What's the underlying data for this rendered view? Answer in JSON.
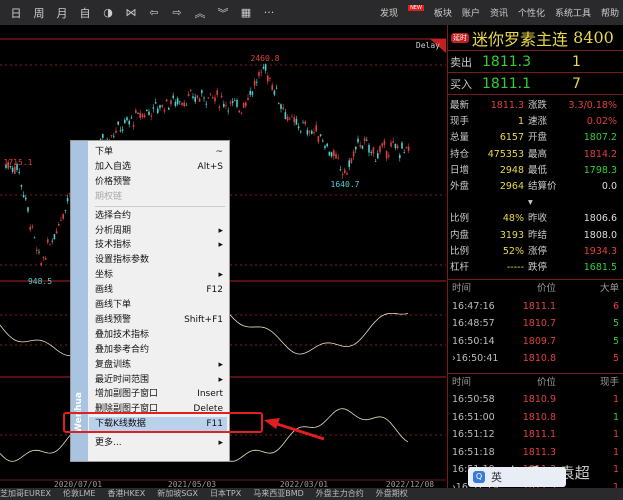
{
  "toolbar": {
    "items": [
      "日",
      "周",
      "月",
      "自",
      "◑",
      "⋈",
      "⇦",
      "⇨",
      "︽",
      "︾",
      "▦",
      "···"
    ],
    "menu": [
      "发现",
      "板块",
      "账户",
      "资讯",
      "个性化",
      "系统工具",
      "帮助"
    ],
    "new_badge": "NEW"
  },
  "chart": {
    "delay_label": "Delay",
    "price_labels": {
      "high": "2460.8",
      "left": "1715.1",
      "low": "948.5",
      "mid": "1640.7"
    },
    "dates": [
      "2020/07/01",
      "2021/05/03",
      "2022/03/01",
      "2022/12/08"
    ]
  },
  "quote": {
    "tag": "延时",
    "name": "迷你罗素主连",
    "code": "8400",
    "sell": {
      "label": "卖出",
      "price": "1811.3",
      "qty": "1"
    },
    "buy": {
      "label": "买入",
      "price": "1811.1",
      "qty": "7"
    },
    "stats": [
      [
        "最新",
        "1811.3",
        "red",
        "涨跌",
        "3.3/0.18%",
        "red"
      ],
      [
        "现手",
        "1",
        "yel",
        "速涨",
        "0.02%",
        "red"
      ],
      [
        "总量",
        "6157",
        "yel",
        "开盘",
        "1807.2",
        "grn"
      ],
      [
        "持仓",
        "475353",
        "yel",
        "最高",
        "1814.2",
        "red"
      ],
      [
        "日增",
        "2948",
        "yel",
        "最低",
        "1798.3",
        "grn"
      ],
      [
        "外盘",
        "2964",
        "yel",
        "结算价 ▾",
        "0.0",
        "wht"
      ],
      [
        "比例",
        "48%",
        "yel",
        "昨收",
        "1806.6",
        "wht"
      ],
      [
        "内盘",
        "3193",
        "yel",
        "昨结",
        "1808.0",
        "wht"
      ],
      [
        "比例",
        "52%",
        "yel",
        "涨停",
        "1934.3",
        "red"
      ],
      [
        "杠杆",
        "-----",
        "yel",
        "跌停",
        "1681.5",
        "grn"
      ]
    ],
    "big": {
      "headers": [
        "时间",
        "价位",
        "大单"
      ],
      "rows": [
        [
          "16:47:16",
          "1811.1",
          "6",
          "red"
        ],
        [
          "16:48:57",
          "1810.7",
          "5",
          "grn"
        ],
        [
          "16:50:14",
          "1809.7",
          "5",
          "grn"
        ],
        [
          "›16:50:41",
          "1810.8",
          "5",
          "red"
        ]
      ]
    },
    "ticks": {
      "headers": [
        "时间",
        "价位",
        "现手"
      ],
      "rows": [
        [
          "16:50:58",
          "1810.9",
          "1",
          "red"
        ],
        [
          "16:51:00",
          "1810.8",
          "1",
          "grn"
        ],
        [
          "16:51:12",
          "1811.1",
          "1",
          "red"
        ],
        [
          "16:51:18",
          "1811.3",
          "1",
          "red"
        ],
        [
          "16:51:19",
          "1811.3",
          "1",
          "red"
        ],
        [
          "›16:51:19",
          "1811.3",
          "1",
          "red"
        ]
      ]
    }
  },
  "context_menu": {
    "strip_text": "Wenhua",
    "items": [
      {
        "label": "下单",
        "key": "~"
      },
      {
        "label": "加入自选",
        "key": "Alt+S"
      },
      {
        "label": "价格预警",
        "key": ""
      },
      {
        "label": "期权链",
        "key": "",
        "disabled": true
      },
      {
        "label": "选择合约",
        "key": ""
      },
      {
        "label": "分析周期",
        "key": "▸"
      },
      {
        "label": "技术指标",
        "key": "▸"
      },
      {
        "label": "设置指标参数",
        "key": ""
      },
      {
        "label": "坐标",
        "key": "▸"
      },
      {
        "label": "画线",
        "key": "F12"
      },
      {
        "label": "画线下单",
        "key": ""
      },
      {
        "label": "画线预警",
        "key": "Shift+F1"
      },
      {
        "label": "叠加技术指标",
        "key": ""
      },
      {
        "label": "叠加参考合约",
        "key": ""
      },
      {
        "label": "复盘训练",
        "key": "▸"
      },
      {
        "label": "最近时间范围",
        "key": "▸"
      },
      {
        "label": "增加副图子窗口",
        "key": "Insert"
      },
      {
        "label": "删除副图子窗口",
        "key": "Delete"
      },
      {
        "label": "下载K线数据",
        "key": "F11",
        "highlighted": true
      },
      {
        "label": "更多...",
        "key": "▸"
      }
    ]
  },
  "watermark": {
    "input_label": "英",
    "text": "知乎 @袁超"
  },
  "bottom_tabs": [
    "芝加哥EUREX",
    "伦敦LME",
    "香港HKEX",
    "新加坡SGX",
    "日本TPX",
    "马来西亚BMD",
    "外盘主力合约",
    "外盘期权"
  ]
}
